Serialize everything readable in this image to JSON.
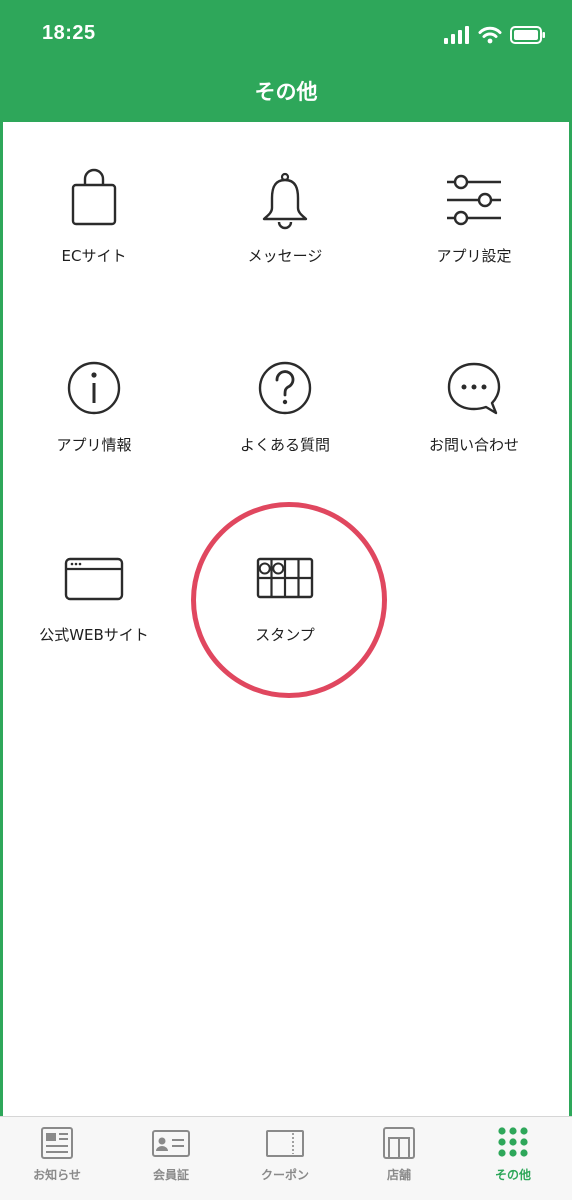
{
  "status_bar": {
    "time": "18:25"
  },
  "header": {
    "title": "その他"
  },
  "menu": {
    "items": [
      {
        "label": "ECサイト",
        "icon": "shopping-bag-icon"
      },
      {
        "label": "メッセージ",
        "icon": "bell-icon"
      },
      {
        "label": "アプリ設定",
        "icon": "sliders-icon"
      },
      {
        "label": "アプリ情報",
        "icon": "info-icon"
      },
      {
        "label": "よくある質問",
        "icon": "question-icon"
      },
      {
        "label": "お問い合わせ",
        "icon": "chat-bubble-icon"
      },
      {
        "label": "公式WEBサイト",
        "icon": "browser-window-icon"
      },
      {
        "label": "スタンプ",
        "icon": "stamp-card-icon"
      }
    ]
  },
  "tabbar": {
    "tabs": [
      {
        "label": "お知らせ",
        "icon": "news-icon"
      },
      {
        "label": "会員証",
        "icon": "member-card-icon"
      },
      {
        "label": "クーポン",
        "icon": "coupon-icon"
      },
      {
        "label": "店舗",
        "icon": "store-icon"
      },
      {
        "label": "その他",
        "icon": "grid-dots-icon",
        "active": true
      }
    ]
  },
  "colors": {
    "brand_green": "#2ea75a",
    "highlight_red": "#e0475f",
    "tab_inactive": "#8a8a8a"
  }
}
